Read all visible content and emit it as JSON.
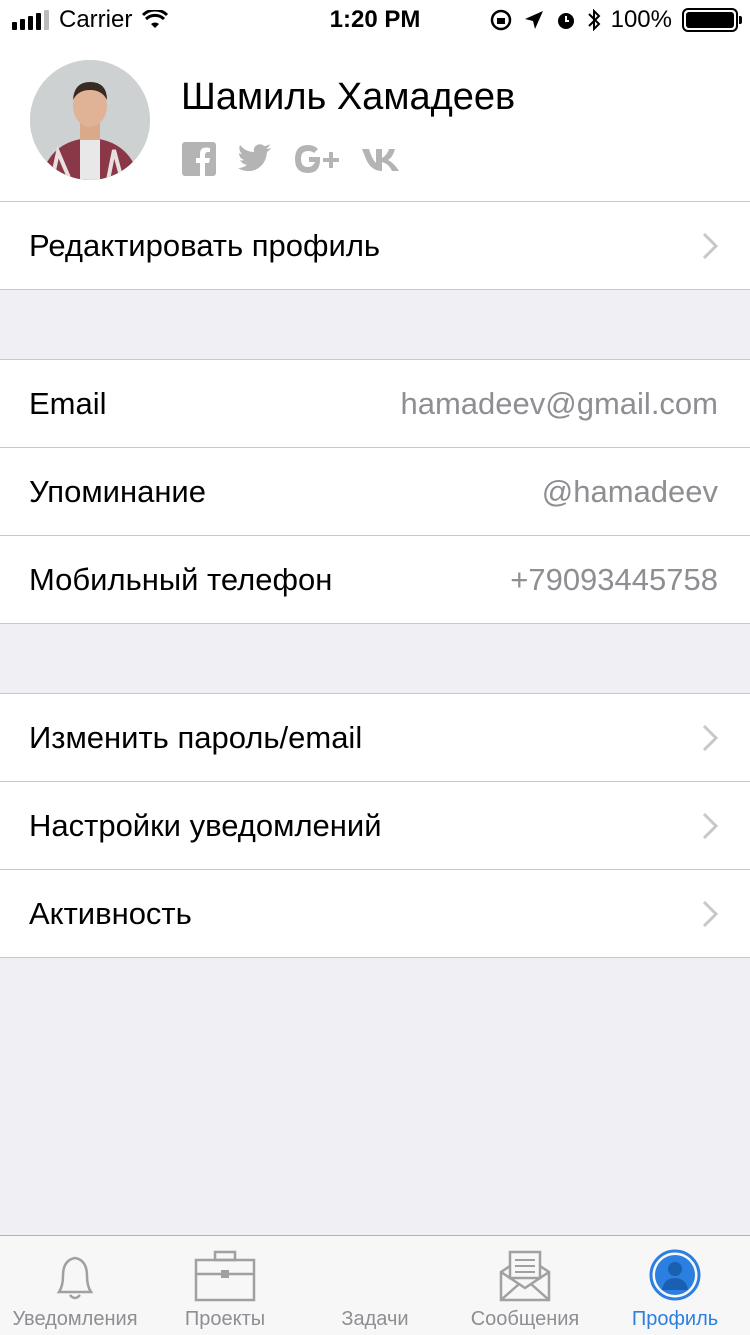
{
  "status_bar": {
    "carrier": "Carrier",
    "time": "1:20 PM",
    "battery_percent": "100%",
    "battery_level": 1.0
  },
  "profile": {
    "name": "Шамиль Хамадеев",
    "social_icons": [
      "facebook-icon",
      "twitter-icon",
      "google-plus-icon",
      "vk-icon"
    ]
  },
  "edit_section": {
    "edit_profile_label": "Редактировать профиль"
  },
  "info_section": {
    "rows": [
      {
        "label": "Email",
        "value": "hamadeev@gmail.com"
      },
      {
        "label": "Упоминание",
        "value": "@hamadeev"
      },
      {
        "label": "Мобильный телефон",
        "value": "+79093445758"
      }
    ]
  },
  "settings_section": {
    "rows": [
      {
        "label": "Изменить пароль/email"
      },
      {
        "label": "Настройки уведомлений"
      },
      {
        "label": "Активность"
      }
    ]
  },
  "tabbar": {
    "tabs": [
      {
        "label": "Уведомления",
        "icon": "bell-icon"
      },
      {
        "label": "Проекты",
        "icon": "briefcase-icon"
      },
      {
        "label": "Задачи",
        "icon": ""
      },
      {
        "label": "Сообщения",
        "icon": "envelope-icon"
      },
      {
        "label": "Профиль",
        "icon": "profile-icon"
      }
    ],
    "active_tab": "Профиль"
  },
  "colors": {
    "accent": "#2b7fe0",
    "background": "#efeff4",
    "secondary_text": "#8e8e93",
    "separator": "#c8c7cc"
  }
}
